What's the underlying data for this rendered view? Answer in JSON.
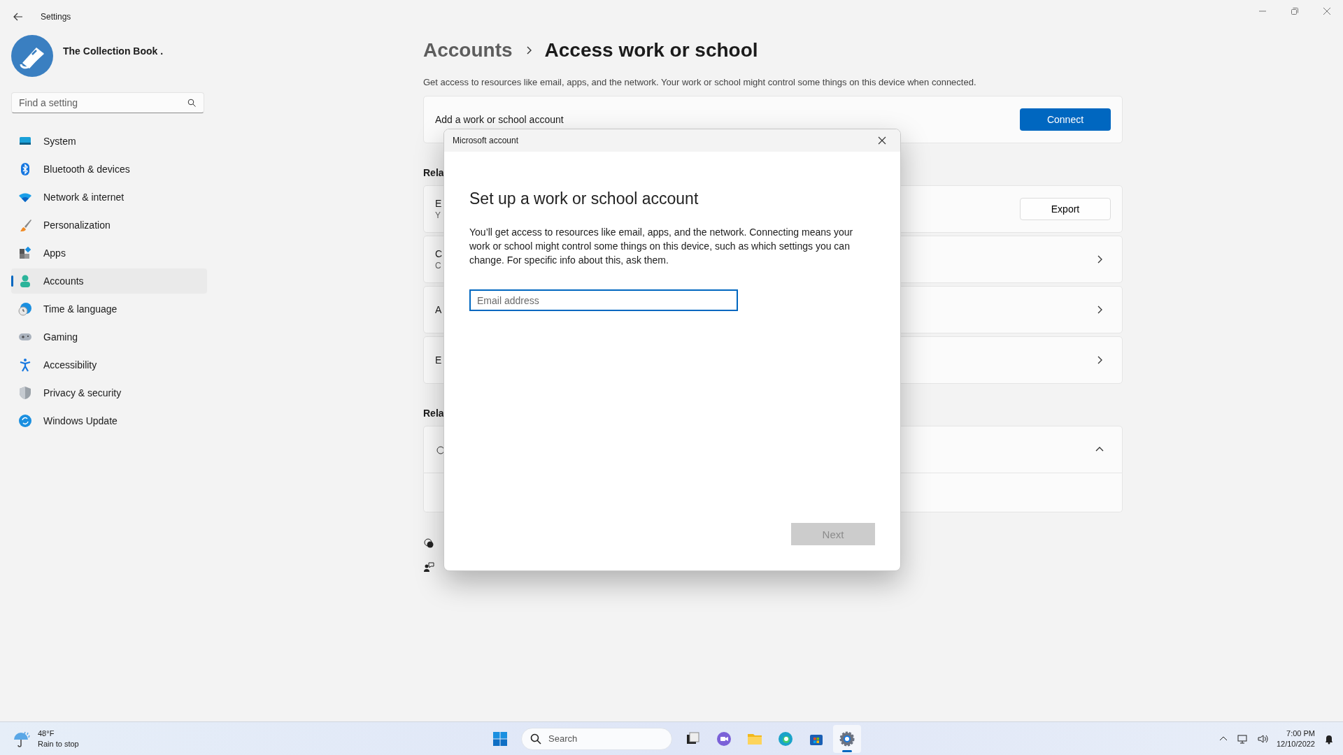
{
  "window": {
    "title": "Settings"
  },
  "profile": {
    "name": "The Collection Book ."
  },
  "search": {
    "placeholder": "Find a setting"
  },
  "nav": [
    {
      "label": "System",
      "kind": "system",
      "selected": false
    },
    {
      "label": "Bluetooth & devices",
      "kind": "bluetooth",
      "selected": false
    },
    {
      "label": "Network & internet",
      "kind": "network",
      "selected": false
    },
    {
      "label": "Personalization",
      "kind": "brush",
      "selected": false
    },
    {
      "label": "Apps",
      "kind": "apps",
      "selected": false
    },
    {
      "label": "Accounts",
      "kind": "accounts",
      "selected": true
    },
    {
      "label": "Time & language",
      "kind": "time",
      "selected": false
    },
    {
      "label": "Gaming",
      "kind": "gaming",
      "selected": false
    },
    {
      "label": "Accessibility",
      "kind": "accessibility",
      "selected": false
    },
    {
      "label": "Privacy & security",
      "kind": "privacy",
      "selected": false
    },
    {
      "label": "Windows Update",
      "kind": "update",
      "selected": false
    }
  ],
  "page": {
    "breadcrumb": "Accounts",
    "title": "Access work or school",
    "description": "Get access to resources like email, apps, and the network. Your work or school might control some things on this device when connected.",
    "add_account": {
      "label": "Add a work or school account",
      "button": "Connect"
    },
    "related_heading": "Rela",
    "cards": [
      {
        "kind": "button",
        "title": "E",
        "subtitle": "Y",
        "button": "Export"
      },
      {
        "kind": "chevron",
        "title": "C",
        "subtitle": "C"
      },
      {
        "kind": "chevron",
        "title": "A"
      },
      {
        "kind": "chevron",
        "title": "E"
      }
    ],
    "related_heading_2": "Rela",
    "related_card": {
      "expanded": true
    }
  },
  "dialog": {
    "title": "Microsoft account",
    "heading": "Set up a work or school account",
    "body": "You’ll get access to resources like email, apps, and the network. Connecting means your work or school might control some things on this device, such as which settings you can change. For specific info about this, ask them.",
    "email": {
      "placeholder": "Email address"
    },
    "next": {
      "label": "Next",
      "disabled": true
    }
  },
  "taskbar": {
    "weather": {
      "temp": "48°F",
      "condition": "Rain to stop"
    },
    "search": {
      "placeholder": "Search"
    },
    "apps": [
      {
        "kind": "taskview",
        "selected": false
      },
      {
        "kind": "chat",
        "selected": false
      },
      {
        "kind": "folder",
        "selected": false
      },
      {
        "kind": "edge",
        "selected": false
      },
      {
        "kind": "store",
        "selected": false
      },
      {
        "kind": "settings",
        "selected": true
      }
    ],
    "clock": {
      "time": "7:00 PM",
      "date": "12/10/2022"
    }
  }
}
